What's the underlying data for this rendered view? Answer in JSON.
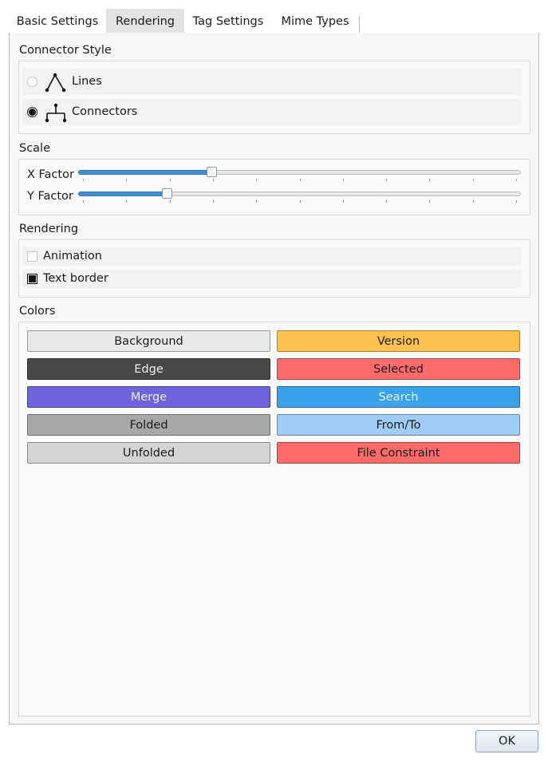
{
  "tabs": [
    {
      "label": "Basic Settings"
    },
    {
      "label": "Rendering"
    },
    {
      "label": "Tag Settings"
    },
    {
      "label": "Mime Types"
    }
  ],
  "active_tab": "Rendering",
  "connector_style": {
    "title": "Connector Style",
    "options": [
      {
        "label": "Lines",
        "checked": false,
        "icon": "lines-icon"
      },
      {
        "label": "Connectors",
        "checked": true,
        "icon": "connectors-icon"
      }
    ]
  },
  "scale": {
    "title": "Scale",
    "x_factor": {
      "label": "X Factor",
      "value_fraction": 0.3
    },
    "y_factor": {
      "label": "Y Factor",
      "value_fraction": 0.2
    }
  },
  "rendering": {
    "title": "Rendering",
    "options": [
      {
        "label": "Animation",
        "checked": false
      },
      {
        "label": "Text border",
        "checked": true
      }
    ]
  },
  "colors": {
    "title": "Colors",
    "buttons": [
      {
        "label": "Background",
        "color": "#e8e8e8",
        "text_color": "#1a1a1a"
      },
      {
        "label": "Version",
        "color": "#ffc34d",
        "text_color": "#1a1a1a"
      },
      {
        "label": "Edge",
        "color": "#474747",
        "text_color": "#f0f0f0"
      },
      {
        "label": "Selected",
        "color": "#ff6b6b",
        "text_color": "#1a1a1a"
      },
      {
        "label": "Merge",
        "color": "#6e63dc",
        "text_color": "#f0f0f0"
      },
      {
        "label": "Search",
        "color": "#3aa2ea",
        "text_color": "#eaf4fc"
      },
      {
        "label": "Folded",
        "color": "#a8a8a8",
        "text_color": "#1a1a1a"
      },
      {
        "label": "From/To",
        "color": "#9fcdf6",
        "text_color": "#1a1a1a"
      },
      {
        "label": "Unfolded",
        "color": "#d4d4d4",
        "text_color": "#1a1a1a"
      },
      {
        "label": "File Constraint",
        "color": "#ff6b6b",
        "text_color": "#1a1a1a"
      }
    ]
  },
  "ok_button": {
    "label": "OK"
  }
}
